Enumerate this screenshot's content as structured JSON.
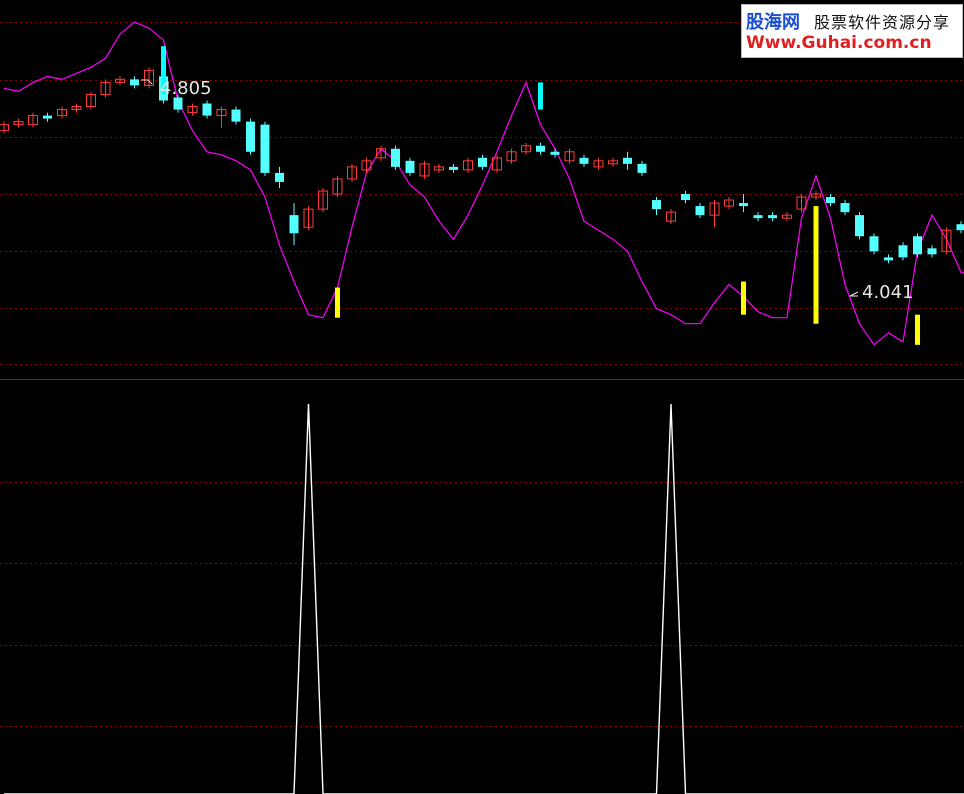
{
  "watermark": {
    "site_name": "股海网",
    "tagline": "股票软件资源分享",
    "url": "Www.Guhai.com.cn"
  },
  "chart_data": [
    {
      "type": "candlestick",
      "panel": "price",
      "ylim": [
        3.8,
        5.0
      ],
      "grid": true,
      "annotations": [
        {
          "text": "4.805",
          "x_index": 10,
          "value": 4.805
        },
        {
          "text": "4.041",
          "x_index": 60,
          "value": 4.041
        }
      ],
      "candles": [
        [
          4.6,
          4.62,
          4.59,
          4.63
        ],
        [
          4.62,
          4.63,
          4.61,
          4.64
        ],
        [
          4.62,
          4.65,
          4.61,
          4.66
        ],
        [
          4.65,
          4.64,
          4.63,
          4.66
        ],
        [
          4.65,
          4.67,
          4.64,
          4.68
        ],
        [
          4.67,
          4.68,
          4.66,
          4.69
        ],
        [
          4.68,
          4.72,
          4.67,
          4.73
        ],
        [
          4.72,
          4.76,
          4.71,
          4.77
        ],
        [
          4.76,
          4.77,
          4.75,
          4.78
        ],
        [
          4.77,
          4.75,
          4.74,
          4.78
        ],
        [
          4.75,
          4.8,
          4.74,
          4.81
        ],
        [
          4.78,
          4.7,
          4.69,
          4.805
        ],
        [
          4.71,
          4.67,
          4.66,
          4.72
        ],
        [
          4.66,
          4.68,
          4.65,
          4.69
        ],
        [
          4.69,
          4.65,
          4.64,
          4.7
        ],
        [
          4.65,
          4.67,
          4.61,
          4.68
        ],
        [
          4.67,
          4.63,
          4.62,
          4.68
        ],
        [
          4.63,
          4.53,
          4.52,
          4.64
        ],
        [
          4.62,
          4.46,
          4.45,
          4.63
        ],
        [
          4.46,
          4.43,
          4.41,
          4.48
        ],
        [
          4.32,
          4.26,
          4.22,
          4.36
        ],
        [
          4.28,
          4.34,
          4.27,
          4.35
        ],
        [
          4.34,
          4.4,
          4.33,
          4.41
        ],
        [
          4.39,
          4.44,
          4.38,
          4.45
        ],
        [
          4.44,
          4.48,
          4.43,
          4.49
        ],
        [
          4.47,
          4.5,
          4.46,
          4.51
        ],
        [
          4.51,
          4.54,
          4.5,
          4.55
        ],
        [
          4.54,
          4.48,
          4.47,
          4.55
        ],
        [
          4.5,
          4.46,
          4.45,
          4.51
        ],
        [
          4.45,
          4.49,
          4.44,
          4.5
        ],
        [
          4.47,
          4.48,
          4.46,
          4.49
        ],
        [
          4.48,
          4.47,
          4.46,
          4.49
        ],
        [
          4.47,
          4.5,
          4.46,
          4.51
        ],
        [
          4.51,
          4.48,
          4.47,
          4.52
        ],
        [
          4.47,
          4.51,
          4.46,
          4.52
        ],
        [
          4.5,
          4.53,
          4.49,
          4.54
        ],
        [
          4.53,
          4.55,
          4.52,
          4.56
        ],
        [
          4.55,
          4.53,
          4.52,
          4.56
        ],
        [
          4.53,
          4.52,
          4.51,
          4.54
        ],
        [
          4.5,
          4.53,
          4.49,
          4.54
        ],
        [
          4.51,
          4.49,
          4.48,
          4.52
        ],
        [
          4.48,
          4.5,
          4.47,
          4.51
        ],
        [
          4.49,
          4.5,
          4.48,
          4.51
        ],
        [
          4.51,
          4.49,
          4.47,
          4.53
        ],
        [
          4.49,
          4.46,
          4.45,
          4.5
        ],
        [
          4.37,
          4.34,
          4.32,
          4.38
        ],
        [
          4.3,
          4.33,
          4.29,
          4.34
        ],
        [
          4.39,
          4.37,
          4.36,
          4.4
        ],
        [
          4.35,
          4.32,
          4.31,
          4.36
        ],
        [
          4.32,
          4.36,
          4.28,
          4.37
        ],
        [
          4.35,
          4.37,
          4.34,
          4.38
        ],
        [
          4.36,
          4.35,
          4.33,
          4.39
        ],
        [
          4.32,
          4.31,
          4.3,
          4.33
        ],
        [
          4.32,
          4.31,
          4.3,
          4.33
        ],
        [
          4.31,
          4.32,
          4.3,
          4.33
        ],
        [
          4.34,
          4.38,
          4.33,
          4.39
        ],
        [
          4.38,
          4.39,
          4.37,
          4.4
        ],
        [
          4.38,
          4.36,
          4.35,
          4.39
        ],
        [
          4.36,
          4.33,
          4.32,
          4.37
        ],
        [
          4.32,
          4.25,
          4.24,
          4.33
        ],
        [
          4.25,
          4.2,
          4.19,
          4.26
        ],
        [
          4.18,
          4.17,
          4.16,
          4.19
        ],
        [
          4.22,
          4.18,
          4.17,
          4.23
        ],
        [
          4.25,
          4.19,
          4.18,
          4.26
        ],
        [
          4.21,
          4.19,
          4.18,
          4.22
        ],
        [
          4.2,
          4.27,
          4.19,
          4.28
        ],
        [
          4.29,
          4.27,
          4.26,
          4.3
        ],
        [
          4.27,
          4.2,
          4.19,
          4.28
        ],
        [
          4.18,
          4.19,
          4.17,
          4.2
        ]
      ],
      "series": [
        {
          "color": "#ff00ff",
          "values": [
            4.74,
            4.73,
            4.76,
            4.78,
            4.77,
            4.79,
            4.81,
            4.84,
            4.92,
            4.96,
            4.94,
            4.9,
            4.7,
            4.6,
            4.53,
            4.52,
            4.5,
            4.47,
            4.38,
            4.22,
            4.1,
            3.99,
            3.98,
            4.08,
            4.28,
            4.46,
            4.54,
            4.5,
            4.42,
            4.38,
            4.3,
            4.24,
            4.32,
            4.42,
            4.53,
            4.65,
            4.76,
            4.62,
            4.54,
            4.44,
            4.3,
            4.27,
            4.24,
            4.2,
            4.1,
            4.01,
            3.99,
            3.96,
            3.96,
            4.03,
            4.09,
            4.05,
            4.0,
            3.98,
            3.98,
            4.31,
            4.45,
            4.31,
            4.09,
            3.96,
            3.89,
            3.93,
            3.9,
            4.2,
            4.32,
            4.24,
            4.13,
            4.12
          ]
        }
      ],
      "markers": [
        {
          "color": "#00ffff",
          "x_index": 11,
          "from": 4.72,
          "to": 4.88
        },
        {
          "color": "#00ffff",
          "x_index": 37,
          "from": 4.67,
          "to": 4.76
        },
        {
          "color": "#ffff00",
          "x_index": 23,
          "from": 3.98,
          "to": 4.08
        },
        {
          "color": "#ffff00",
          "x_index": 51,
          "from": 3.99,
          "to": 4.1
        },
        {
          "color": "#ffff00",
          "x_index": 56,
          "from": 3.96,
          "to": 4.35
        },
        {
          "color": "#ffff00",
          "x_index": 63,
          "from": 3.89,
          "to": 3.99
        }
      ]
    },
    {
      "type": "line",
      "panel": "signal",
      "ylim": [
        0,
        1
      ],
      "grid": true,
      "series": [
        {
          "color": "#ffffff",
          "values": [
            0,
            0,
            0,
            0,
            0,
            0,
            0,
            0,
            0,
            0,
            0,
            0,
            0,
            0,
            0,
            0,
            0,
            0,
            0,
            0,
            0,
            1,
            0,
            0,
            0,
            0,
            0,
            0,
            0,
            0,
            0,
            0,
            0,
            0,
            0,
            0,
            0,
            0,
            0,
            0,
            0,
            0,
            0,
            0,
            0,
            0,
            1,
            0,
            0,
            0,
            0,
            0,
            0,
            0,
            0,
            0,
            0,
            0,
            0,
            0,
            0,
            0,
            0,
            0,
            0,
            0,
            0,
            0
          ]
        }
      ]
    }
  ]
}
